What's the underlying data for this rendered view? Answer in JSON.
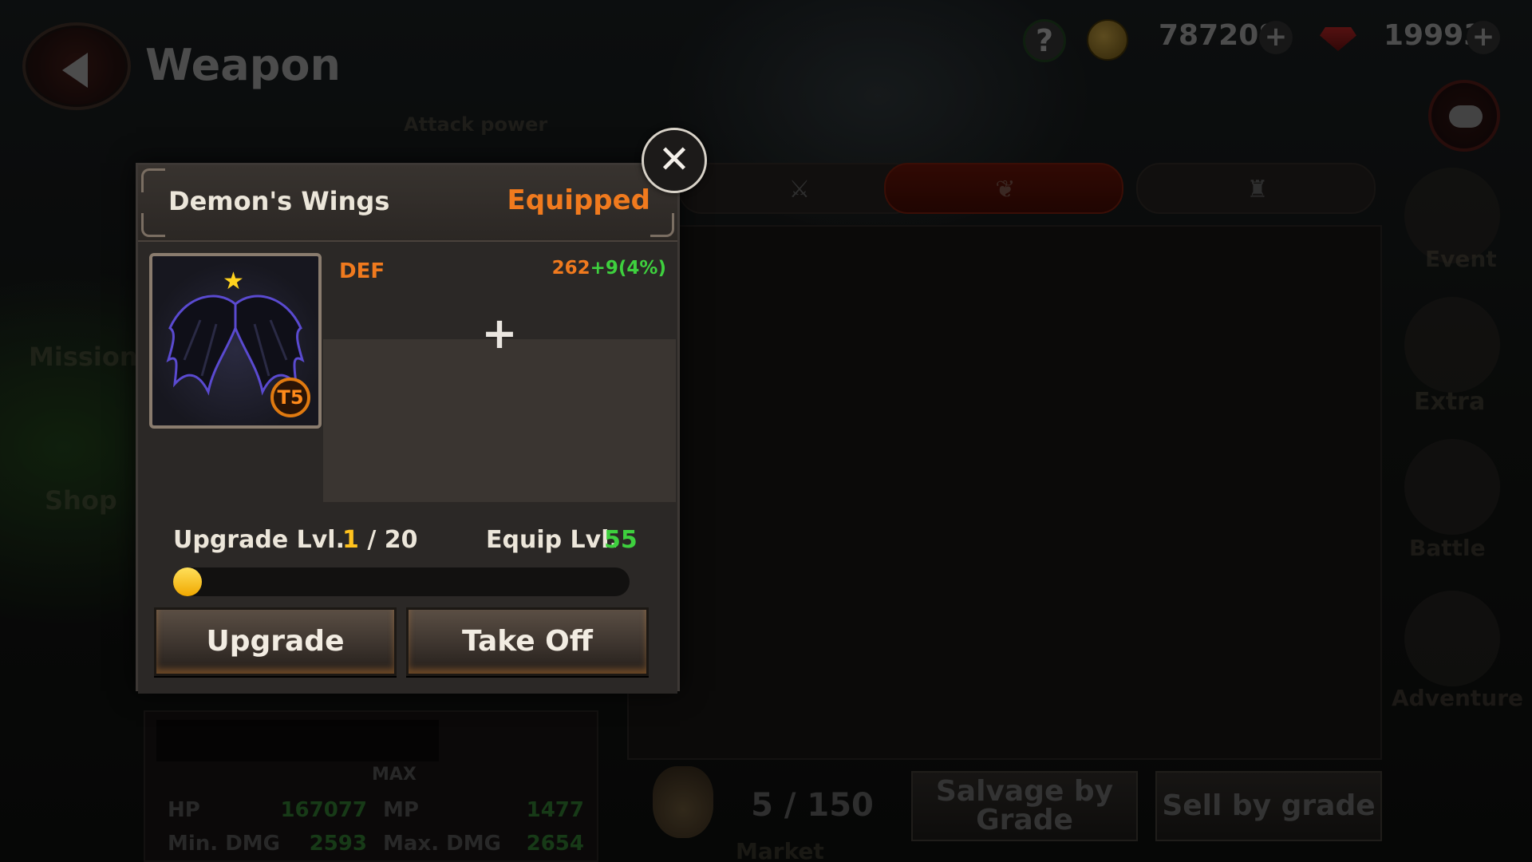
{
  "header": {
    "title": "Weapon",
    "help_label": "?",
    "gold_amount": "787208",
    "gem_amount": "19993",
    "plus_label": "+"
  },
  "background": {
    "ghost_labels": {
      "mission": "Mission",
      "shop": "Shop",
      "event": "Event",
      "extra": "Extra",
      "battle": "Battle",
      "adventure": "Adventure",
      "market": "Market",
      "attack_power": "Attack power"
    },
    "inventory_count": "5 / 150",
    "salvage_button": "Salvage by Grade",
    "sell_button": "Sell by grade",
    "stats": {
      "max_label": "MAX",
      "hp_label": "HP",
      "hp_value": "167077",
      "mp_label": "MP",
      "mp_value": "1477",
      "min_dmg_label": "Min. DMG",
      "min_dmg_value": "2593",
      "max_dmg_label": "Max. DMG",
      "max_dmg_value": "2654"
    }
  },
  "modal": {
    "item_name": "Demon's Wings",
    "status": "Equipped",
    "close_label": "✕",
    "tier": "T5",
    "stat_label": "DEF",
    "stat_base": "262",
    "stat_bonus": "+9(4%)",
    "add_option_label": "+",
    "upgrade_label": "Upgrade Lvl.",
    "upgrade_current": "1",
    "upgrade_max": " / 20",
    "upgrade_progress": 0.05,
    "equip_label": "Equip Lvl.",
    "equip_value": "55",
    "upgrade_button": "Upgrade",
    "takeoff_button": "Take Off"
  },
  "colors": {
    "accent_orange": "#f07a1e",
    "bonus_green": "#3ed03e",
    "progress_yellow": "#ffc21e"
  }
}
